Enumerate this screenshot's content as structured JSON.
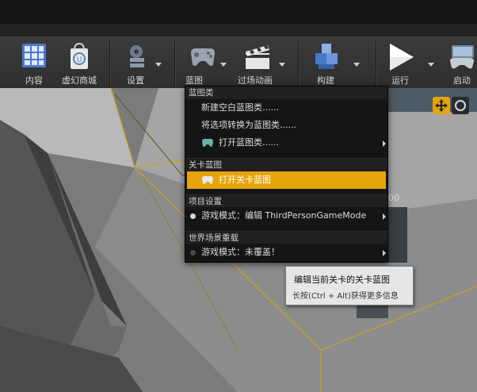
{
  "toolbar": {
    "items": [
      {
        "label": "内容",
        "icon": "content-grid-icon"
      },
      {
        "label": "虚幻商城",
        "icon": "marketplace-bag-icon"
      },
      {
        "label": "设置",
        "icon": "settings-gear-icon"
      },
      {
        "label": "蓝图",
        "icon": "blueprint-gamepad-icon"
      },
      {
        "label": "过场动画",
        "icon": "cinematics-clapper-icon"
      },
      {
        "label": "构建",
        "icon": "build-cubes-icon"
      },
      {
        "label": "运行",
        "icon": "play-triangle-icon"
      },
      {
        "label": "启动",
        "icon": "launch-gamepad-icon"
      }
    ]
  },
  "menu": {
    "sections": {
      "blueprint_class": "蓝图类",
      "level_blueprint": "关卡蓝图",
      "project_settings": "项目设置",
      "world_override": "世界场景重载"
    },
    "items": {
      "new_blank": "新建空白蓝图类......",
      "convert": "将选项转换为蓝图类......",
      "open_class": "打开蓝图类......",
      "open_level": "打开关卡蓝图",
      "game_mode_edit": "游戏模式：编辑 ThirdPersonGameMode",
      "game_mode_none": "游戏模式：未覆盖！"
    }
  },
  "tooltip": {
    "title": "编辑当前关卡的关卡蓝图",
    "desc": "长按(Ctrl + Alt)获得更多信息"
  },
  "colors": {
    "highlight": "#e5a40b",
    "toolbar_bg": "#333333",
    "menu_bg": "#151515",
    "viewport_floor": "#7b7b7b"
  }
}
